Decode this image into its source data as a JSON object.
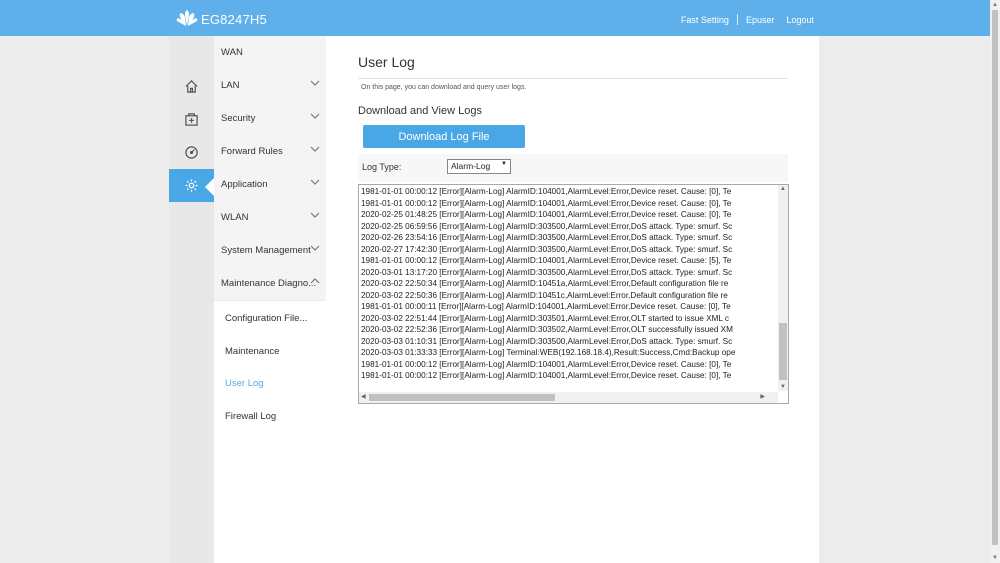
{
  "header": {
    "brand": "EG8247H5",
    "links": [
      "Fast Setting",
      "Epuser",
      "Logout"
    ],
    "brand_color": "#5fb0ea"
  },
  "iconbar": {
    "icons": [
      "home-icon",
      "plus-box-icon",
      "gauge-icon",
      "gear-icon"
    ],
    "active": "gear-icon",
    "accent": "#4aa7e6"
  },
  "menu": {
    "items": [
      {
        "label": "WAN"
      },
      {
        "label": "LAN"
      },
      {
        "label": "Security"
      },
      {
        "label": "Forward Rules"
      },
      {
        "label": "Application"
      },
      {
        "label": "WLAN"
      },
      {
        "label": "System Management"
      },
      {
        "label": "Maintenance Diagno..."
      }
    ],
    "subitems": [
      {
        "label": "Configuration File..."
      },
      {
        "label": "Maintenance"
      },
      {
        "label": "User Log"
      },
      {
        "label": "Firewall Log"
      }
    ],
    "current_sub": "User Log"
  },
  "main": {
    "title": "User Log",
    "description": "On this page, you can download and query user logs.",
    "section_title": "Download and View Logs",
    "download_button": "Download Log File",
    "log_type_label": "Log Type:",
    "log_type_value": "Alarm-Log",
    "log_lines": [
      "1981-01-01 00:00:12 [Error][Alarm-Log] AlarmID:104001,AlarmLevel:Error,Device reset. Cause: [0], Te",
      "1981-01-01 00:00:12 [Error][Alarm-Log] AlarmID:104001,AlarmLevel:Error,Device reset. Cause: [0], Te",
      "2020-02-25 01:48:25 [Error][Alarm-Log] AlarmID:104001,AlarmLevel:Error,Device reset. Cause: [0], Te",
      "2020-02-25 06:59:56 [Error][Alarm-Log] AlarmID:303500,AlarmLevel:Error,DoS attack. Type: smurf. Sc",
      "2020-02-26 23:54:16 [Error][Alarm-Log] AlarmID:303500,AlarmLevel:Error,DoS attack. Type: smurf. Sc",
      "2020-02-27 17:42:30 [Error][Alarm-Log] AlarmID:303500,AlarmLevel:Error,DoS attack. Type: smurf. Sc",
      "1981-01-01 00:00:12 [Error][Alarm-Log] AlarmID:104001,AlarmLevel:Error,Device reset. Cause: [5], Te",
      "2020-03-01 13:17:20 [Error][Alarm-Log] AlarmID:303500,AlarmLevel:Error,DoS attack. Type: smurf. Sc",
      "2020-03-02 22:50:34 [Error][Alarm-Log] AlarmID:10451a,AlarmLevel:Error,Default configuration file re",
      "2020-03-02 22:50:36 [Error][Alarm-Log] AlarmID:10451c,AlarmLevel:Error,Default configuration file re",
      "1981-01-01 00:00:11 [Error][Alarm-Log] AlarmID:104001,AlarmLevel:Error,Device reset. Cause: [0], Te",
      "2020-03-02 22:51:44 [Error][Alarm-Log] AlarmID:303501,AlarmLevel:Error,OLT started to issue XML c",
      "2020-03-02 22:52:36 [Error][Alarm-Log] AlarmID:303502,AlarmLevel:Error,OLT successfully issued XM",
      "2020-03-03 01:10:31 [Error][Alarm-Log] AlarmID:303500,AlarmLevel:Error,DoS attack. Type: smurf. Sc",
      "2020-03-03 01:33:33 [Error][Alarm-Log] Terminal:WEB(192.168.18.4),Result:Success,Cmd:Backup ope",
      "1981-01-01 00:00:12 [Error][Alarm-Log] AlarmID:104001,AlarmLevel:Error,Device reset. Cause: [0], Te",
      "1981-01-01 00:00:12 [Error][Alarm-Log] AlarmID:104001,AlarmLevel:Error,Device reset. Cause: [0], Te"
    ]
  }
}
